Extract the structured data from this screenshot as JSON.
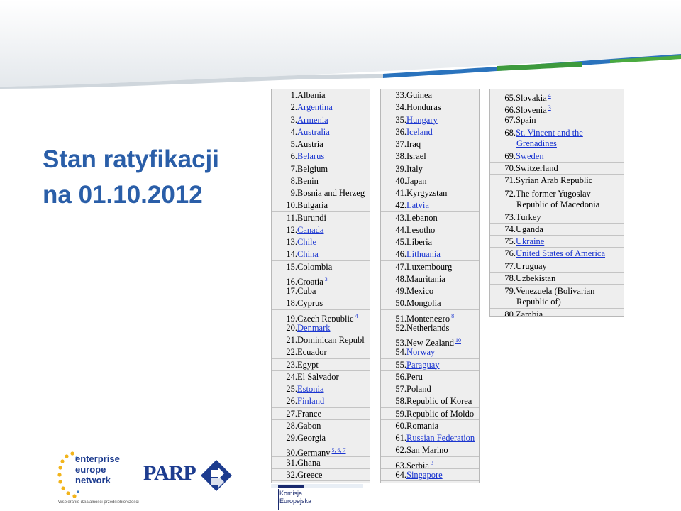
{
  "title": {
    "line1": "Stan ratyfikacji",
    "line2": "na 01.10.2012"
  },
  "colors": {
    "title": "#2a5ea8",
    "link": "#1a35d0",
    "banner_blue": "#1f6eb5",
    "banner_green": "#3c9a3c"
  },
  "table": {
    "col1": [
      {
        "num": "1.",
        "name": "Albania",
        "link": false,
        "ref": ""
      },
      {
        "num": "2.",
        "name": "Argentina",
        "link": true,
        "ref": ""
      },
      {
        "num": "3.",
        "name": "Armenia",
        "link": true,
        "ref": ""
      },
      {
        "num": "4.",
        "name": "Australia",
        "link": true,
        "ref": ""
      },
      {
        "num": "5.",
        "name": "Austria",
        "link": false,
        "ref": ""
      },
      {
        "num": "6.",
        "name": "Belarus",
        "link": true,
        "ref": ""
      },
      {
        "num": "7.",
        "name": "Belgium",
        "link": false,
        "ref": ""
      },
      {
        "num": "8.",
        "name": "Benin",
        "link": false,
        "ref": ""
      },
      {
        "num": "9.",
        "name": "Bosnia and Herzeg",
        "link": false,
        "ref": ""
      },
      {
        "num": "10.",
        "name": "Bulgaria",
        "link": false,
        "ref": ""
      },
      {
        "num": "11.",
        "name": "Burundi",
        "link": false,
        "ref": ""
      },
      {
        "num": "12.",
        "name": "Canada",
        "link": true,
        "ref": ""
      },
      {
        "num": "13.",
        "name": "Chile",
        "link": true,
        "ref": ""
      },
      {
        "num": "14.",
        "name": "China",
        "link": true,
        "ref": ""
      },
      {
        "num": "15.",
        "name": "Colombia",
        "link": false,
        "ref": ""
      },
      {
        "num": "16.",
        "name": "Croatia",
        "link": false,
        "ref": "3"
      },
      {
        "num": "17.",
        "name": "Cuba",
        "link": false,
        "ref": ""
      },
      {
        "num": "18.",
        "name": "Cyprus",
        "link": false,
        "ref": ""
      },
      {
        "num": "19.",
        "name": "Czech Republic",
        "link": false,
        "ref": "4"
      },
      {
        "num": "20.",
        "name": "Denmark",
        "link": true,
        "ref": ""
      },
      {
        "num": "21.",
        "name": "Dominican Republ",
        "link": false,
        "ref": ""
      },
      {
        "num": "22.",
        "name": "Ecuador",
        "link": false,
        "ref": ""
      },
      {
        "num": "23.",
        "name": "Egypt",
        "link": false,
        "ref": ""
      },
      {
        "num": "24.",
        "name": "El Salvador",
        "link": false,
        "ref": ""
      },
      {
        "num": "25.",
        "name": "Estonia",
        "link": true,
        "ref": ""
      },
      {
        "num": "26.",
        "name": "Finland",
        "link": true,
        "ref": ""
      },
      {
        "num": "27.",
        "name": "France",
        "link": false,
        "ref": ""
      },
      {
        "num": "28.",
        "name": "Gabon",
        "link": false,
        "ref": ""
      },
      {
        "num": "29.",
        "name": "Georgia",
        "link": false,
        "ref": ""
      },
      {
        "num": "30.",
        "name": "Germany",
        "link": false,
        "ref": "5, 6, 7"
      },
      {
        "num": "31.",
        "name": "Ghana",
        "link": false,
        "ref": ""
      },
      {
        "num": "32.",
        "name": "Greece",
        "link": false,
        "ref": ""
      }
    ],
    "col2": [
      {
        "num": "33.",
        "name": "Guinea",
        "link": false,
        "ref": ""
      },
      {
        "num": "34.",
        "name": "Honduras",
        "link": false,
        "ref": ""
      },
      {
        "num": "35.",
        "name": "Hungary",
        "link": true,
        "ref": ""
      },
      {
        "num": "36.",
        "name": "Iceland",
        "link": true,
        "ref": ""
      },
      {
        "num": "37.",
        "name": "Iraq",
        "link": false,
        "ref": ""
      },
      {
        "num": "38.",
        "name": "Israel",
        "link": false,
        "ref": ""
      },
      {
        "num": "39.",
        "name": "Italy",
        "link": false,
        "ref": ""
      },
      {
        "num": "40.",
        "name": "Japan",
        "link": false,
        "ref": ""
      },
      {
        "num": "41.",
        "name": "Kyrgyzstan",
        "link": false,
        "ref": ""
      },
      {
        "num": "42.",
        "name": "Latvia",
        "link": true,
        "ref": ""
      },
      {
        "num": "43.",
        "name": "Lebanon",
        "link": false,
        "ref": ""
      },
      {
        "num": "44.",
        "name": "Lesotho",
        "link": false,
        "ref": ""
      },
      {
        "num": "45.",
        "name": "Liberia",
        "link": false,
        "ref": ""
      },
      {
        "num": "46.",
        "name": "Lithuania",
        "link": true,
        "ref": ""
      },
      {
        "num": "47.",
        "name": "Luxembourg",
        "link": false,
        "ref": ""
      },
      {
        "num": "48.",
        "name": "Mauritania",
        "link": false,
        "ref": ""
      },
      {
        "num": "49.",
        "name": "Mexico",
        "link": false,
        "ref": ""
      },
      {
        "num": "50.",
        "name": "Mongolia",
        "link": false,
        "ref": ""
      },
      {
        "num": "51.",
        "name": "Montenegro",
        "link": false,
        "ref": "8"
      },
      {
        "num": "52.",
        "name": "Netherlands",
        "link": false,
        "ref": ""
      },
      {
        "num": "53.",
        "name": "New Zealand",
        "link": false,
        "ref": "10"
      },
      {
        "num": "54.",
        "name": "Norway",
        "link": true,
        "ref": ""
      },
      {
        "num": "55.",
        "name": "Paraguay",
        "link": true,
        "ref": ""
      },
      {
        "num": "56.",
        "name": "Peru",
        "link": false,
        "ref": ""
      },
      {
        "num": "57.",
        "name": "Poland",
        "link": false,
        "ref": ""
      },
      {
        "num": "58.",
        "name": "Republic of Korea",
        "link": false,
        "ref": ""
      },
      {
        "num": "59.",
        "name": "Republic of Moldo",
        "link": false,
        "ref": ""
      },
      {
        "num": "60.",
        "name": "Romania",
        "link": false,
        "ref": ""
      },
      {
        "num": "61.",
        "name": "Russian Federation",
        "link": true,
        "ref": ""
      },
      {
        "num": "62.",
        "name": "San Marino",
        "link": false,
        "ref": ""
      },
      {
        "num": "63.",
        "name": "Serbia",
        "link": false,
        "ref": "3"
      },
      {
        "num": "64.",
        "name": "Singapore",
        "link": true,
        "ref": ""
      }
    ],
    "col3": [
      {
        "num": "65.",
        "name": "Slovakia",
        "link": false,
        "ref": "4"
      },
      {
        "num": "66.",
        "name": "Slovenia",
        "link": false,
        "ref": "3"
      },
      {
        "num": "67.",
        "name": "Spain",
        "link": false,
        "ref": ""
      },
      {
        "num": "68.",
        "name": "St. Vincent and the Grenadines",
        "link": true,
        "ref": "",
        "tall": true
      },
      {
        "num": "69.",
        "name": "Sweden",
        "link": true,
        "ref": ""
      },
      {
        "num": "70.",
        "name": "Switzerland",
        "link": false,
        "ref": ""
      },
      {
        "num": "71.",
        "name": "Syrian Arab Republic",
        "link": false,
        "ref": ""
      },
      {
        "num": "72.",
        "name": "The former Yugoslav Republic of Macedonia",
        "link": false,
        "ref": "",
        "tall": true
      },
      {
        "num": "73.",
        "name": "Turkey",
        "link": false,
        "ref": ""
      },
      {
        "num": "74.",
        "name": "Uganda",
        "link": false,
        "ref": ""
      },
      {
        "num": "75.",
        "name": "Ukraine",
        "link": true,
        "ref": ""
      },
      {
        "num": "76.",
        "name": "United States of America",
        "link": true,
        "ref": ""
      },
      {
        "num": "77.",
        "name": "Uruguay",
        "link": false,
        "ref": ""
      },
      {
        "num": "78.",
        "name": "Uzbekistan",
        "link": false,
        "ref": ""
      },
      {
        "num": "79.",
        "name": "Venezuela (Bolivarian Republic of)",
        "link": false,
        "ref": "",
        "tall": true
      },
      {
        "num": "80.",
        "name": "Zambia",
        "link": false,
        "ref": ""
      }
    ]
  },
  "logos": {
    "een": {
      "line1": "enterprise",
      "line2": "europe",
      "line3": "network",
      "tagline": "Wspieranie dzialalnosci przedsiebiorczosci"
    },
    "parp": {
      "text": "PARP"
    },
    "ec": {
      "line1": "Komisja",
      "line2": "Europejska"
    }
  }
}
